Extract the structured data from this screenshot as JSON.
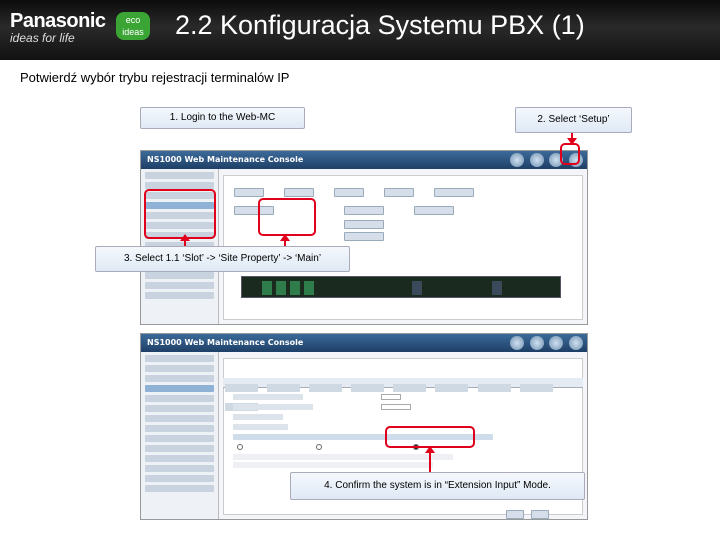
{
  "header": {
    "brand_name": "Panasonic",
    "brand_tagline": "ideas for life",
    "eco_badge": "eco ideas",
    "title": "2.2 Konfiguracja Systemu PBX (1)"
  },
  "subtitle": "Potwierdź wybór trybu rejestracji terminalów IP",
  "steps": {
    "step1": "1. Login to the Web-MC",
    "step2": "2. Select ‘Setup’",
    "step3": "3. Select 1.1 ‘Slot’ -> ‘Site Property’ -> ‘Main’",
    "step4": "4. Confirm the system is in “Extension Input” Mode."
  },
  "screens": {
    "top_app_title": "NS1000 Web Maintenance Console",
    "bottom_app_title": "NS1000 Web Maintenance Console"
  },
  "colors": {
    "accent_red": "#e0001b",
    "header_dark": "#111111",
    "callout_bg": "#dfe9f5"
  }
}
